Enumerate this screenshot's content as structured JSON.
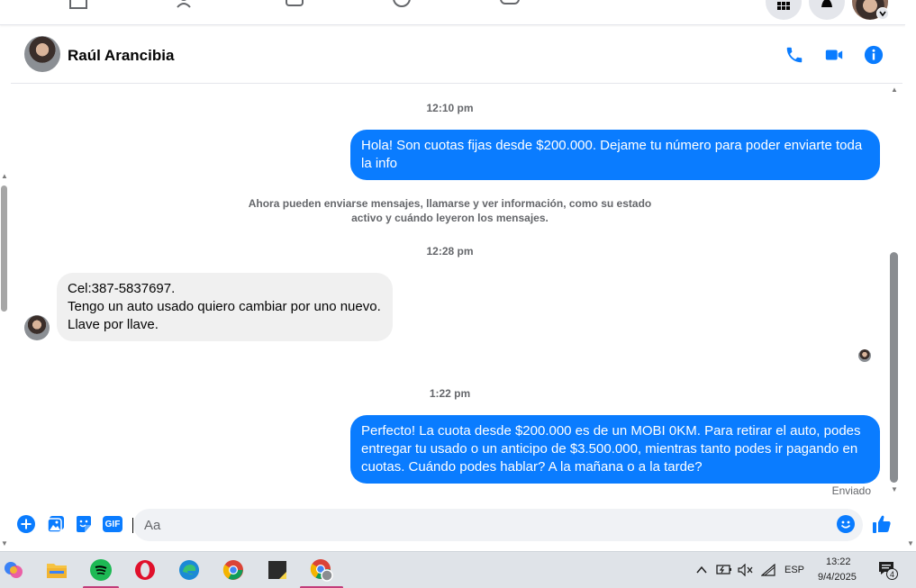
{
  "header": {
    "contact_name": "Raúl Arancibia"
  },
  "icons": {
    "phone": "phone-icon",
    "video": "video-camera-icon",
    "info": "info-icon"
  },
  "colors": {
    "accent": "#0a7cff",
    "incoming_bubble": "#f0f0f0",
    "text_secondary": "#65676b"
  },
  "messages": {
    "time_1": "12:10 pm",
    "out_1_line1": "Hola! Son cuotas fijas desde $200.000. Dejame tu número para poder enviarte toda",
    "out_1_line2": "la info",
    "system_line1": "Ahora pueden enviarse mensajes, llamarse y ver información, como su estado",
    "system_line2": "activo y cuándo leyeron los mensajes.",
    "time_2": "12:28 pm",
    "in_1_line1": "Cel:387-5837697.",
    "in_1_line2": "Tengo un auto usado quiero cambiar por uno nuevo.",
    "in_1_line3": "Llave por llave.",
    "time_3": "1:22 pm",
    "out_2_line1": "Perfecto! La cuota desde $200.000 es de un MOBI 0KM. Para retirar el auto, podes",
    "out_2_line2": "entregar tu usado o un anticipo de $3.500.000, mientras tanto podes ir pagando en",
    "out_2_line3": "cuotas. Cuándo podes hablar? A la mañana o a la tarde?",
    "status": "Enviado"
  },
  "composer": {
    "placeholder": "Aa",
    "gif_label": "GIF"
  },
  "taskbar": {
    "language": "ESP",
    "time": "13:22",
    "date": "9/4/2025",
    "notification_count": "4"
  }
}
